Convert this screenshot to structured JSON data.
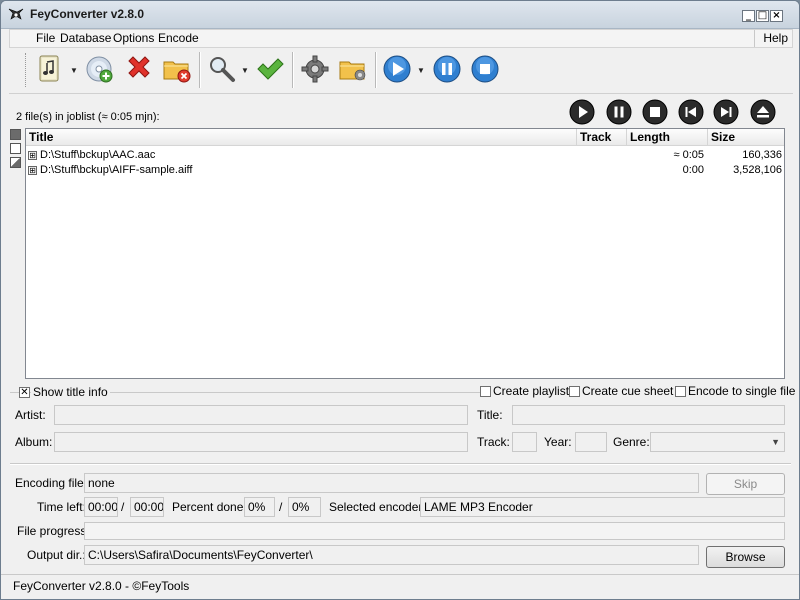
{
  "window": {
    "title": "FeyConverter v2.8.0",
    "controls": {
      "minimize": "_",
      "maximize": "□",
      "close": "×"
    }
  },
  "menu": {
    "items": [
      "File",
      "Database",
      "Options",
      "Encode"
    ],
    "help": "Help"
  },
  "toolbar": {
    "icons": [
      "add-music-icon",
      "add-disc-icon",
      "remove-icon",
      "clear-folder-icon",
      "search-icon",
      "checkmark-icon",
      "settings-gear-icon",
      "open-folder-icon",
      "play-icon",
      "pause-icon",
      "stop-icon"
    ]
  },
  "joblist": {
    "count_text": "2 file(s) in joblist (≈ 0:05 mjn):",
    "columns": [
      "Title",
      "Track",
      "Length",
      "Size"
    ],
    "rows": [
      {
        "expander": "⊞",
        "title": "D:\\Stuff\\bckup\\AAC.aac",
        "track": "",
        "length": "≈ 0:05",
        "size": "160,336"
      },
      {
        "expander": "⊞",
        "title": "D:\\Stuff\\bckup\\AIFF-sample.aiff",
        "track": "",
        "length": "0:00",
        "size": "3,528,106"
      }
    ]
  },
  "player": {
    "icons": [
      "play-icon",
      "pause-icon",
      "stop-icon",
      "previous-track-icon",
      "next-track-icon",
      "eject-icon"
    ]
  },
  "title_info": {
    "show_title_info_label": "Show title info",
    "show_title_info_checked": true,
    "create_playlist_label": "Create playlist",
    "create_cue_sheet_label": "Create cue sheet",
    "encode_single_label": "Encode to single file",
    "artist_label": "Artist:",
    "artist_value": "",
    "title_label": "Title:",
    "title_value": "",
    "album_label": "Album:",
    "album_value": "",
    "track_label": "Track:",
    "track_value": "",
    "year_label": "Year:",
    "year_value": "",
    "genre_label": "Genre:",
    "genre_value": ""
  },
  "encoding": {
    "encoding_file_label": "Encoding file:",
    "encoding_file_value": "none",
    "skip_label": "Skip",
    "time_left_label": "Time left:",
    "time_left_value": "00:00",
    "time_total_value": "00:00",
    "slash": "/",
    "percent_done_label": "Percent done:",
    "percent_done_value": "0%",
    "percent_total_value": "0%",
    "selected_encoder_label": "Selected encoder:",
    "selected_encoder_value": "LAME MP3 Encoder",
    "file_progress_label": "File progress:",
    "file_progress": 0,
    "output_dir_label": "Output dir.:",
    "output_dir_value": "C:\\Users\\Safira\\Documents\\FeyConverter\\",
    "browse_label": "Browse"
  },
  "status": {
    "text": "FeyConverter v2.8.0 - ©FeyTools"
  }
}
